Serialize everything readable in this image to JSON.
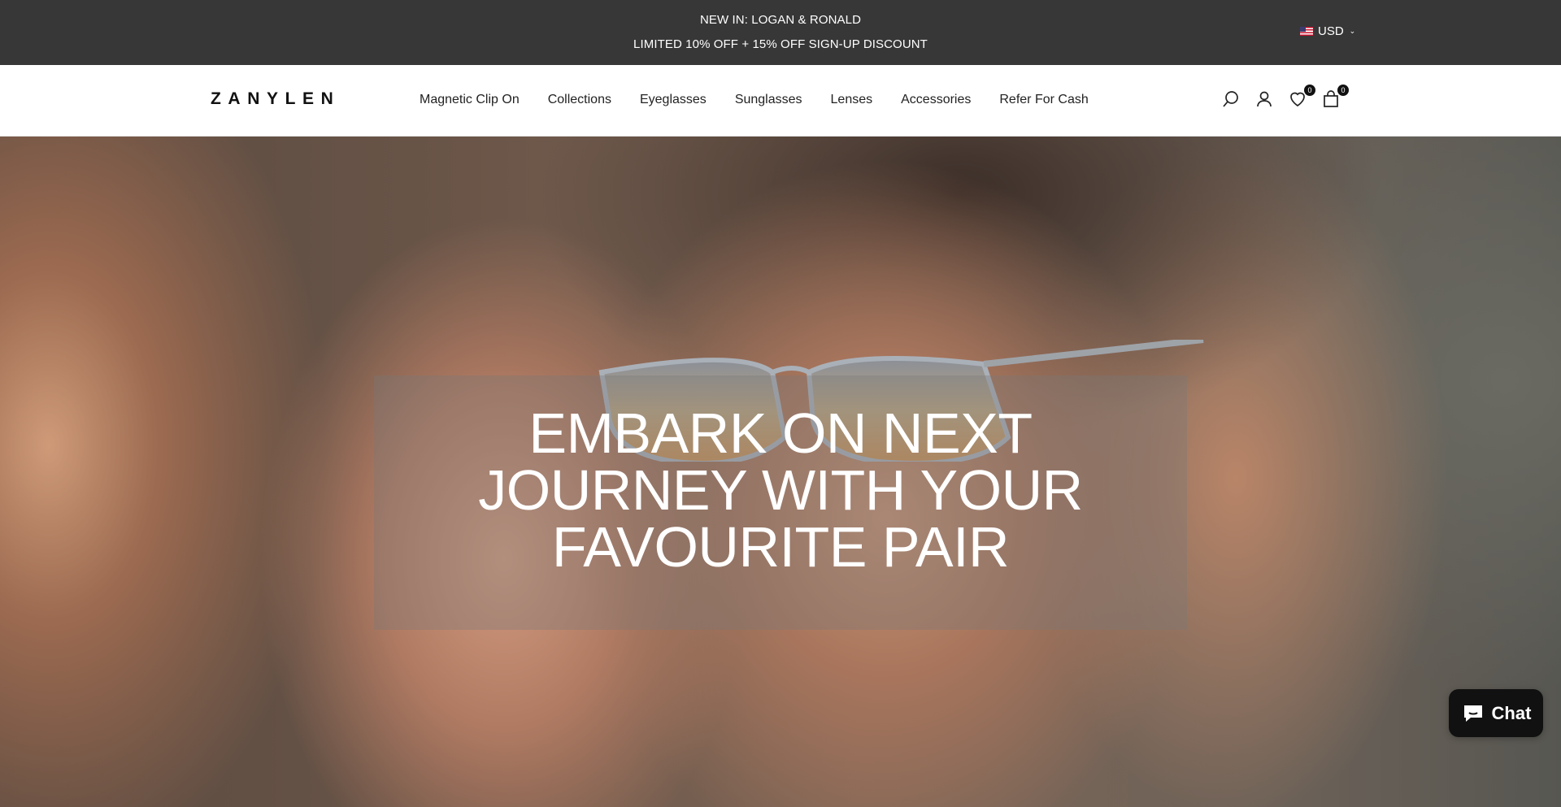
{
  "announcement": {
    "line1": "NEW IN: LOGAN & RONALD",
    "line2": "LIMITED 10% OFF + 15% OFF SIGN-UP DISCOUNT",
    "currency": "USD",
    "currency_flag_icon": "us-flag-icon"
  },
  "header": {
    "logo": "ZANYLEN",
    "nav": [
      {
        "label": "Magnetic Clip On"
      },
      {
        "label": "Collections"
      },
      {
        "label": "Eyeglasses"
      },
      {
        "label": "Sunglasses"
      },
      {
        "label": "Lenses"
      },
      {
        "label": "Accessories"
      },
      {
        "label": "Refer For Cash"
      }
    ],
    "icons": {
      "search": "search-icon",
      "account": "account-icon",
      "wishlist": "heart-icon",
      "cart": "shopping-bag-icon"
    },
    "wishlist_count": "0",
    "cart_count": "0"
  },
  "hero": {
    "headline_line1": "EMBARK ON NEXT",
    "headline_line2": "JOURNEY WITH YOUR",
    "headline_line3": "FAVOURITE PAIR"
  },
  "chat": {
    "label": "Chat",
    "icon": "chat-bubble-icon",
    "color": "#111111"
  },
  "colors": {
    "announcement_bg": "#373737",
    "header_bg": "#ffffff",
    "text_dark": "#222222"
  }
}
